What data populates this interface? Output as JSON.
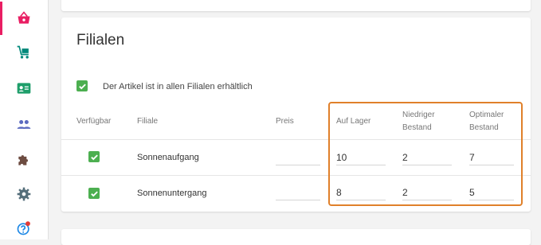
{
  "sidebar": {
    "items": [
      {
        "icon": "shopping-basket-icon",
        "active": true
      },
      {
        "icon": "cart-icon",
        "active": false
      },
      {
        "icon": "contact-card-icon",
        "active": false
      },
      {
        "icon": "people-icon",
        "active": false
      },
      {
        "icon": "puzzle-icon",
        "active": false
      },
      {
        "icon": "gear-icon",
        "active": false
      },
      {
        "icon": "help-icon",
        "active": false,
        "notification": true
      }
    ]
  },
  "section": {
    "title": "Filialen",
    "available_all_label": "Der Artikel ist in allen Filialen erhältlich",
    "available_all_checked": true
  },
  "table": {
    "headers": {
      "available": "Verfügbar",
      "branch": "Filiale",
      "price": "Preis",
      "stock": "Auf Lager",
      "low_stock_1": "Niedriger",
      "low_stock_2": "Bestand",
      "optimal_stock_1": "Optimaler",
      "optimal_stock_2": "Bestand"
    },
    "rows": [
      {
        "available": true,
        "branch": "Sonnenaufgang",
        "price": "",
        "stock": "10",
        "low_stock": "2",
        "optimal_stock": "7"
      },
      {
        "available": true,
        "branch": "Sonnenuntergang",
        "price": "",
        "stock": "8",
        "low_stock": "2",
        "optimal_stock": "5"
      }
    ]
  },
  "colors": {
    "accent": "#e91e63",
    "teal": "#00897b",
    "green": "#4caf50",
    "slate": "#5c6bc0",
    "highlight": "#e0802a"
  }
}
